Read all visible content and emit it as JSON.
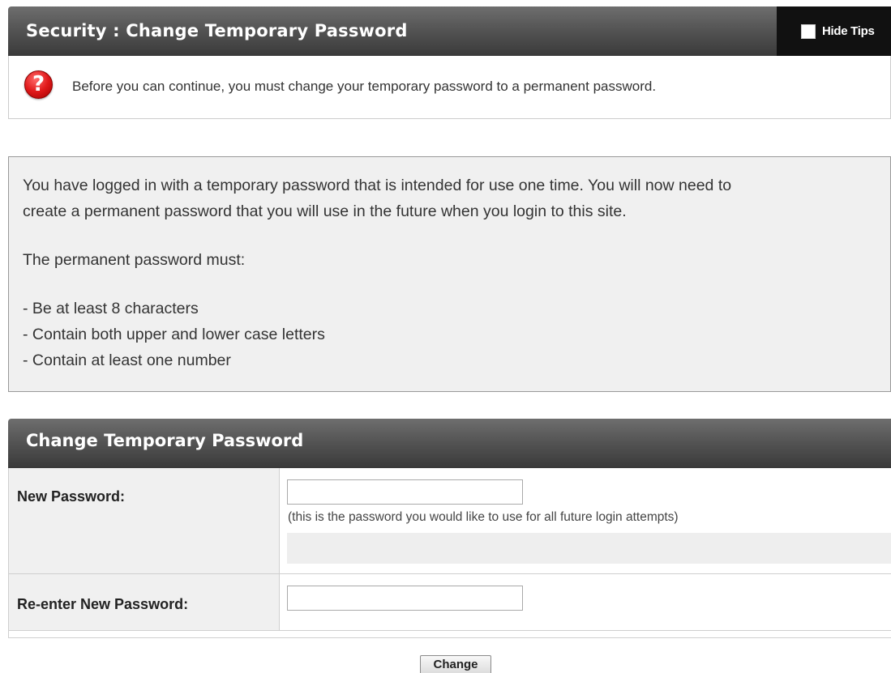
{
  "header": {
    "title": "Security : Change Temporary Password",
    "hide_tips_label": "Hide Tips",
    "hide_tips_checked": false
  },
  "tip": {
    "icon": "question-icon",
    "text": "Before you can continue, you must change your temporary password to a permanent password."
  },
  "info": {
    "para1_line1": "You have logged in with a temporary password that is intended for use one time. You will now need to",
    "para1_line2": "create a permanent password that you will use in the future when you login to this site.",
    "para2": "The permanent password must:",
    "rules": [
      "- Be at least 8 characters",
      "- Contain both upper and lower case letters",
      "- Contain at least one number"
    ]
  },
  "form": {
    "title": "Change Temporary Password",
    "new_password_label": "New Password:",
    "new_password_value": "",
    "new_password_hint": "(this is the password you would like to use for all future login attempts)",
    "reenter_label": "Re-enter New Password:",
    "reenter_value": "",
    "submit_label": "Change"
  },
  "colors": {
    "header_gradient_top": "#6e6e6e",
    "header_gradient_bottom": "#3a3a3a",
    "hide_tips_bg": "#111111",
    "info_bg": "#f0f0f0",
    "icon_red": "#e0191a"
  }
}
